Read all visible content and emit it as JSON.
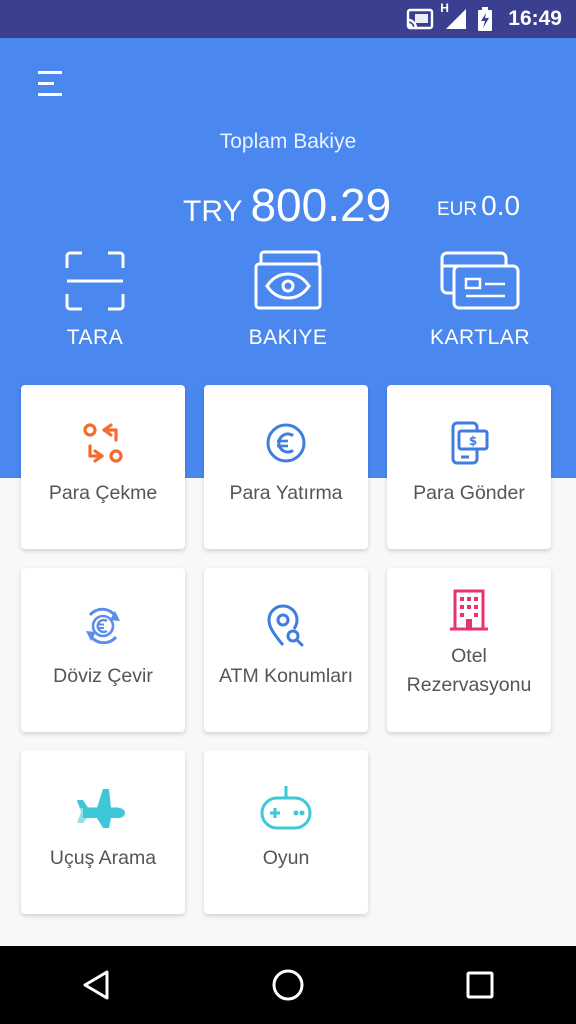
{
  "status_bar": {
    "time": "16:49",
    "network": "H"
  },
  "balance": {
    "label": "Toplam Bakiye",
    "try_currency": "TRY",
    "try_amount": "800.29",
    "eur_currency": "EUR",
    "eur_amount": "0.0"
  },
  "actions": [
    {
      "label": "TARA",
      "icon": "scan-frame-icon"
    },
    {
      "label": "BAKIYE",
      "icon": "banknote-icon"
    },
    {
      "label": "KARTLAR",
      "icon": "cards-icon"
    }
  ],
  "services": [
    {
      "label": "Para Çekme",
      "icon": "swap-arrows-icon",
      "color": "#f26c2f"
    },
    {
      "label": "Para Yatırma",
      "icon": "euro-coin-icon",
      "color": "#3f7de0"
    },
    {
      "label": "Para Gönder",
      "icon": "phone-money-icon",
      "color": "#3f7de0"
    },
    {
      "label": "Döviz Çevir",
      "icon": "euro-exchange-icon",
      "color": "#5b8ee8"
    },
    {
      "label": "ATM Konumları",
      "icon": "map-pin-search-icon",
      "color": "#3f7de0"
    },
    {
      "label": "Otel Rezervasyonu",
      "icon": "hotel-building-icon",
      "color": "#e8336b"
    },
    {
      "label": "Uçuş Arama",
      "icon": "airplane-icon",
      "color": "#3ec7d6"
    },
    {
      "label": "Oyun",
      "icon": "gamepad-icon",
      "color": "#3ec7d6"
    }
  ],
  "colors": {
    "header": "#4a87ef",
    "status_bar": "#3b3f8f",
    "background": "#f7f8fa"
  }
}
